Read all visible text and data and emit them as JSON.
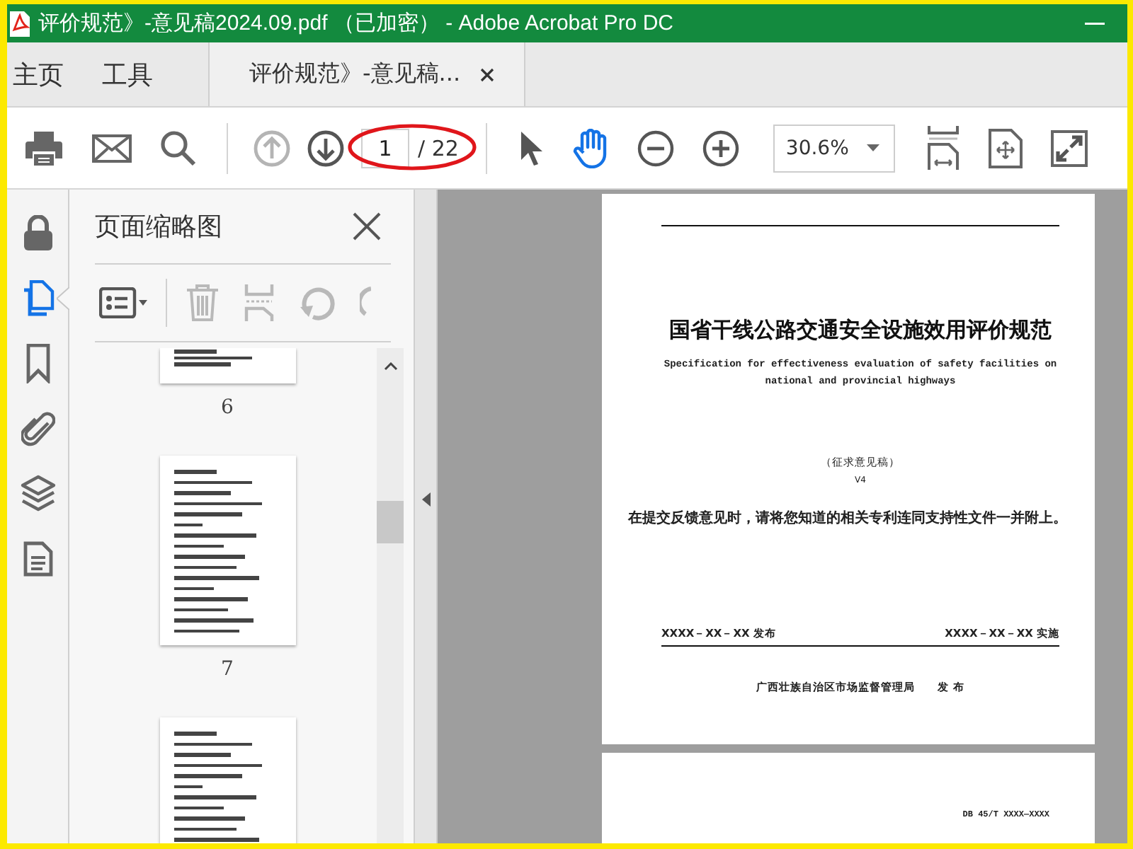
{
  "window": {
    "title": "评价规范》-意见稿2024.09.pdf （已加密） - Adobe Acrobat Pro DC"
  },
  "tabs": [
    {
      "kind": "nav",
      "label": "主页",
      "selected": false
    },
    {
      "kind": "nav",
      "label": "工具",
      "selected": false
    },
    {
      "kind": "document",
      "label": "评价规范》-意见稿...",
      "selected": true
    }
  ],
  "toolbar": {
    "page_nav": [
      {
        "kind": "previous",
        "disabled": true
      },
      {
        "kind": "next",
        "disabled": false
      }
    ],
    "page_number": "1",
    "page_count": "/ 22",
    "tools": [
      {
        "kind": "select",
        "selected": false
      },
      {
        "kind": "hand",
        "selected": true
      }
    ],
    "zoom": "30.6%"
  },
  "sidebar": {
    "items": [
      {
        "kind": "lock",
        "selected": false
      },
      {
        "kind": "pages",
        "selected": true
      },
      {
        "kind": "bookmark",
        "selected": false
      },
      {
        "kind": "attachment",
        "selected": false
      },
      {
        "kind": "layers",
        "selected": false
      },
      {
        "kind": "document",
        "selected": false
      }
    ]
  },
  "thumbnails_panel": {
    "title": "页面缩略图",
    "tools": [
      {
        "kind": "options",
        "disabled": false
      },
      {
        "kind": "delete",
        "disabled": true
      },
      {
        "kind": "insert",
        "disabled": true
      },
      {
        "kind": "rotate-left",
        "disabled": true
      },
      {
        "kind": "rotate-right",
        "disabled": true
      }
    ],
    "thumbnails": [
      {
        "label": "6"
      },
      {
        "label": "7"
      }
    ]
  },
  "document": {
    "cover": {
      "title": "国省干线公路交通安全设施效用评价规范",
      "subtitle": "Specification for effectiveness evaluation of safety facilities on national and provincial highways",
      "stage": "（征求意见稿）",
      "version": "V4",
      "note": "在提交反馈意见时，请将您知道的相关专利连同支持性文件一并附上。",
      "issue_date": "XXXX－XX－XX 发布",
      "effective_date": "XXXX－XX－XX 实施",
      "issuer": "广西壮族自治区市场监督管理局",
      "issuer_action": "发 布"
    },
    "next_page": {
      "code": "DB 45/T XXXX—XXXX"
    }
  }
}
